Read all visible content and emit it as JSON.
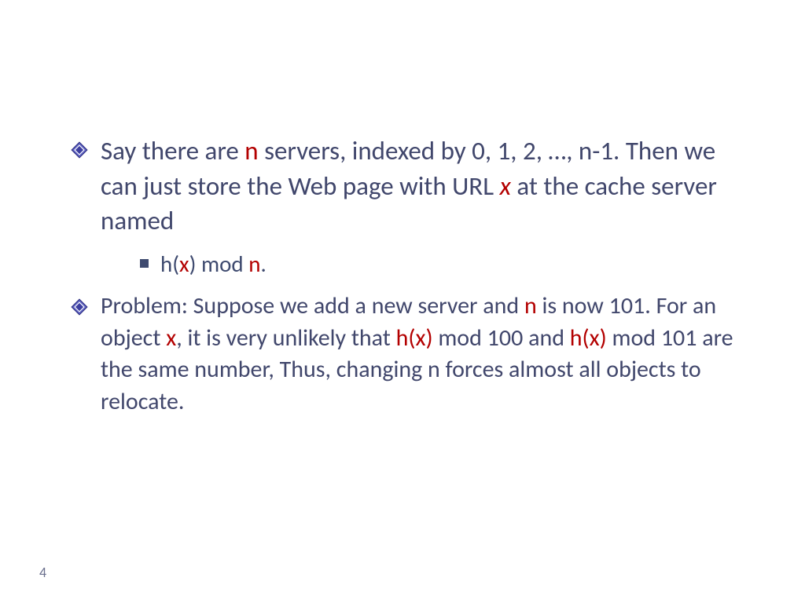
{
  "slide": {
    "bullet1": {
      "p1": "Say there are ",
      "n": "n",
      "p2": " servers, indexed by 0, 1, 2, …, n-1. Then we can just store the Web page with URL ",
      "x": "x",
      "p3": " at the cache server named"
    },
    "sub1": {
      "p1": "h(",
      "x": "x",
      "p2": ") mod ",
      "n": "n",
      "p3": "."
    },
    "bullet2": {
      "p1": "Problem: Suppose we add a new server and ",
      "n1": "n",
      "p2": " is now 101. For an object ",
      "x": "x",
      "p3": ", it is very unlikely that ",
      "hx1": "h(x)",
      "p4": " mod 100 and ",
      "hx2": "h(x)",
      "p5": " mod 101 are the same number, Thus, changing n forces almost all objects to relocate."
    },
    "page_number": "4"
  },
  "colors": {
    "text": "#41476c",
    "highlight": "#b30000",
    "bullet_fill": "#4a4fa8",
    "bullet_border": "#28297a"
  }
}
